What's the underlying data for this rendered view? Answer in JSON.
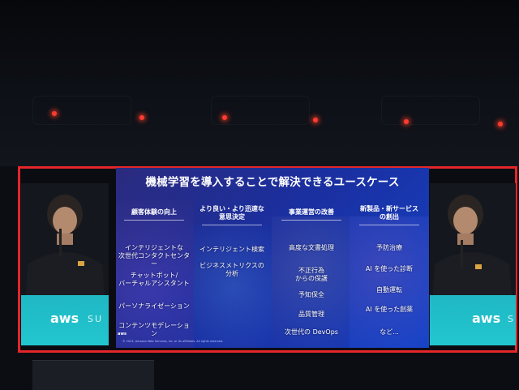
{
  "slide": {
    "title": "機械学習を導入することで解決できるユースケース",
    "columns": [
      {
        "heading": "顧客体験の向上",
        "items": [
          "インテリジェントな\n次世代コンタクトセンター",
          "チャットボット/\nバーチャルアシスタント",
          "パーソナライゼーション",
          "コンテンツモデレーション"
        ]
      },
      {
        "heading": "より良い・より迅速な\n意思決定",
        "items": [
          "インテリジェント検索",
          "ビジネスメトリクスの\n分析"
        ]
      },
      {
        "heading": "事業運営の改善",
        "items": [
          "高度な文書処理",
          "不正行為\nからの保護",
          "予知保全",
          "品質管理",
          "次世代の DevOps"
        ]
      },
      {
        "heading": "新製品・新サービス\nの創出",
        "items": [
          "予防治療",
          "AI を使った診断",
          "自動運転",
          "AI を使った創薬",
          "など..."
        ]
      }
    ],
    "footer": "© 2023, Amazon Web Services, Inc. or its affiliates. All rights reserved.",
    "logo_text": "aws"
  },
  "side_screens": {
    "left": {
      "logo_text": "aws",
      "event_text": "SU"
    },
    "right": {
      "logo_text": "aws",
      "event_text": "S"
    }
  },
  "colors": {
    "frame": "#e4262a",
    "slide_bg": "#1a2fa0",
    "side_panel": "#22c6cf"
  }
}
